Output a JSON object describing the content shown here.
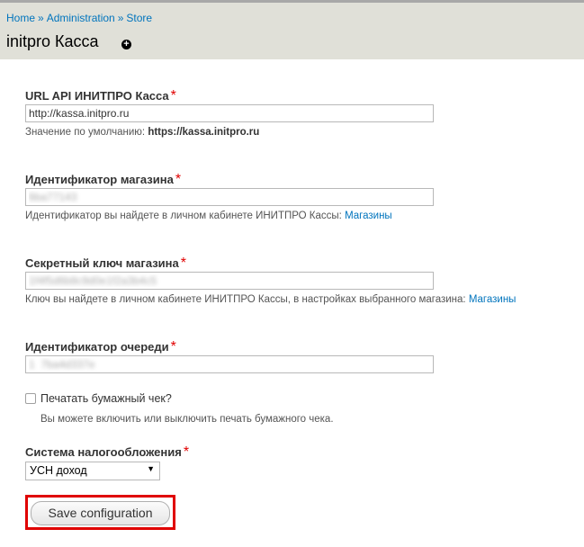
{
  "breadcrumb": {
    "items": [
      "Home",
      "Administration",
      "Store"
    ],
    "separator": "»"
  },
  "page": {
    "title": "initpro Касса",
    "shortcut_icon": "plus-circle-icon"
  },
  "form": {
    "url": {
      "label": "URL API ИНИТПРО Касса",
      "required_mark": "*",
      "value": "http://kassa.initpro.ru",
      "desc_prefix": "Значение по умолчанию:",
      "desc_default": "https://kassa.initpro.ru"
    },
    "shop_id": {
      "label": "Идентификатор магазина",
      "required_mark": "*",
      "value": "6ba77143",
      "desc": "Идентификатор вы найдете в личном кабинете ИНИТПРО Кассы:",
      "link": "Магазины"
    },
    "secret": {
      "label": "Секретный ключ магазина",
      "required_mark": "*",
      "value": "1f4f5d6b8c9d0e1f2a3b4c5",
      "desc": "Ключ вы найдете в личном кабинете ИНИТПРО Кассы, в настройках выбранного магазина:",
      "link": "Магазины"
    },
    "queue": {
      "label": "Идентификатор очереди",
      "required_mark": "*",
      "value": "1  7ba4d337e",
      "desc": ""
    },
    "print": {
      "label": "Печатать бумажный чек?",
      "checked": false,
      "desc": "Вы можете включить или выключить печать бумажного чека."
    },
    "tax": {
      "label": "Система налогообложения",
      "required_mark": "*",
      "selected": "УСН доход"
    },
    "save_label": "Save configuration"
  },
  "colors": {
    "link": "#0074bd",
    "required": "#e00000",
    "highlight": "#e00000",
    "header_bg": "#e0e0d8"
  }
}
